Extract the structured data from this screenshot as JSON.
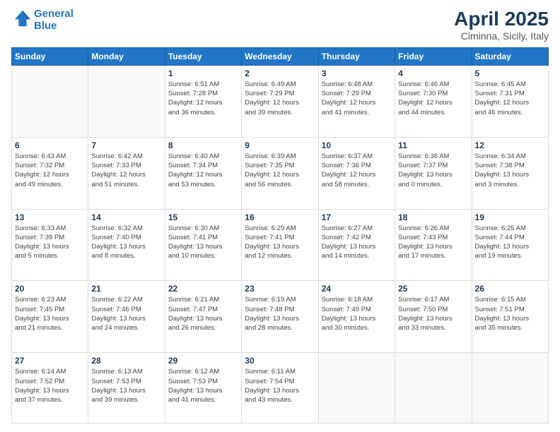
{
  "header": {
    "logo_line1": "General",
    "logo_line2": "Blue",
    "main_title": "April 2025",
    "subtitle": "Ciminna, Sicily, Italy"
  },
  "weekdays": [
    "Sunday",
    "Monday",
    "Tuesday",
    "Wednesday",
    "Thursday",
    "Friday",
    "Saturday"
  ],
  "weeks": [
    [
      {
        "day": "",
        "info": ""
      },
      {
        "day": "",
        "info": ""
      },
      {
        "day": "1",
        "info": "Sunrise: 6:51 AM\nSunset: 7:28 PM\nDaylight: 12 hours\nand 36 minutes."
      },
      {
        "day": "2",
        "info": "Sunrise: 6:49 AM\nSunset: 7:29 PM\nDaylight: 12 hours\nand 39 minutes."
      },
      {
        "day": "3",
        "info": "Sunrise: 6:48 AM\nSunset: 7:29 PM\nDaylight: 12 hours\nand 41 minutes."
      },
      {
        "day": "4",
        "info": "Sunrise: 6:46 AM\nSunset: 7:30 PM\nDaylight: 12 hours\nand 44 minutes."
      },
      {
        "day": "5",
        "info": "Sunrise: 6:45 AM\nSunset: 7:31 PM\nDaylight: 12 hours\nand 46 minutes."
      }
    ],
    [
      {
        "day": "6",
        "info": "Sunrise: 6:43 AM\nSunset: 7:32 PM\nDaylight: 12 hours\nand 49 minutes."
      },
      {
        "day": "7",
        "info": "Sunrise: 6:42 AM\nSunset: 7:33 PM\nDaylight: 12 hours\nand 51 minutes."
      },
      {
        "day": "8",
        "info": "Sunrise: 6:40 AM\nSunset: 7:34 PM\nDaylight: 12 hours\nand 53 minutes."
      },
      {
        "day": "9",
        "info": "Sunrise: 6:39 AM\nSunset: 7:35 PM\nDaylight: 12 hours\nand 56 minutes."
      },
      {
        "day": "10",
        "info": "Sunrise: 6:37 AM\nSunset: 7:36 PM\nDaylight: 12 hours\nand 58 minutes."
      },
      {
        "day": "11",
        "info": "Sunrise: 6:36 AM\nSunset: 7:37 PM\nDaylight: 13 hours\nand 0 minutes."
      },
      {
        "day": "12",
        "info": "Sunrise: 6:34 AM\nSunset: 7:38 PM\nDaylight: 13 hours\nand 3 minutes."
      }
    ],
    [
      {
        "day": "13",
        "info": "Sunrise: 6:33 AM\nSunset: 7:39 PM\nDaylight: 13 hours\nand 5 minutes."
      },
      {
        "day": "14",
        "info": "Sunrise: 6:32 AM\nSunset: 7:40 PM\nDaylight: 13 hours\nand 8 minutes."
      },
      {
        "day": "15",
        "info": "Sunrise: 6:30 AM\nSunset: 7:41 PM\nDaylight: 13 hours\nand 10 minutes."
      },
      {
        "day": "16",
        "info": "Sunrise: 6:29 AM\nSunset: 7:41 PM\nDaylight: 13 hours\nand 12 minutes."
      },
      {
        "day": "17",
        "info": "Sunrise: 6:27 AM\nSunset: 7:42 PM\nDaylight: 13 hours\nand 14 minutes."
      },
      {
        "day": "18",
        "info": "Sunrise: 6:26 AM\nSunset: 7:43 PM\nDaylight: 13 hours\nand 17 minutes."
      },
      {
        "day": "19",
        "info": "Sunrise: 6:25 AM\nSunset: 7:44 PM\nDaylight: 13 hours\nand 19 minutes."
      }
    ],
    [
      {
        "day": "20",
        "info": "Sunrise: 6:23 AM\nSunset: 7:45 PM\nDaylight: 13 hours\nand 21 minutes."
      },
      {
        "day": "21",
        "info": "Sunrise: 6:22 AM\nSunset: 7:46 PM\nDaylight: 13 hours\nand 24 minutes."
      },
      {
        "day": "22",
        "info": "Sunrise: 6:21 AM\nSunset: 7:47 PM\nDaylight: 13 hours\nand 26 minutes."
      },
      {
        "day": "23",
        "info": "Sunrise: 6:19 AM\nSunset: 7:48 PM\nDaylight: 13 hours\nand 28 minutes."
      },
      {
        "day": "24",
        "info": "Sunrise: 6:18 AM\nSunset: 7:49 PM\nDaylight: 13 hours\nand 30 minutes."
      },
      {
        "day": "25",
        "info": "Sunrise: 6:17 AM\nSunset: 7:50 PM\nDaylight: 13 hours\nand 33 minutes."
      },
      {
        "day": "26",
        "info": "Sunrise: 6:15 AM\nSunset: 7:51 PM\nDaylight: 13 hours\nand 35 minutes."
      }
    ],
    [
      {
        "day": "27",
        "info": "Sunrise: 6:14 AM\nSunset: 7:52 PM\nDaylight: 13 hours\nand 37 minutes."
      },
      {
        "day": "28",
        "info": "Sunrise: 6:13 AM\nSunset: 7:53 PM\nDaylight: 13 hours\nand 39 minutes."
      },
      {
        "day": "29",
        "info": "Sunrise: 6:12 AM\nSunset: 7:53 PM\nDaylight: 13 hours\nand 41 minutes."
      },
      {
        "day": "30",
        "info": "Sunrise: 6:11 AM\nSunset: 7:54 PM\nDaylight: 13 hours\nand 43 minutes."
      },
      {
        "day": "",
        "info": ""
      },
      {
        "day": "",
        "info": ""
      },
      {
        "day": "",
        "info": ""
      }
    ]
  ]
}
